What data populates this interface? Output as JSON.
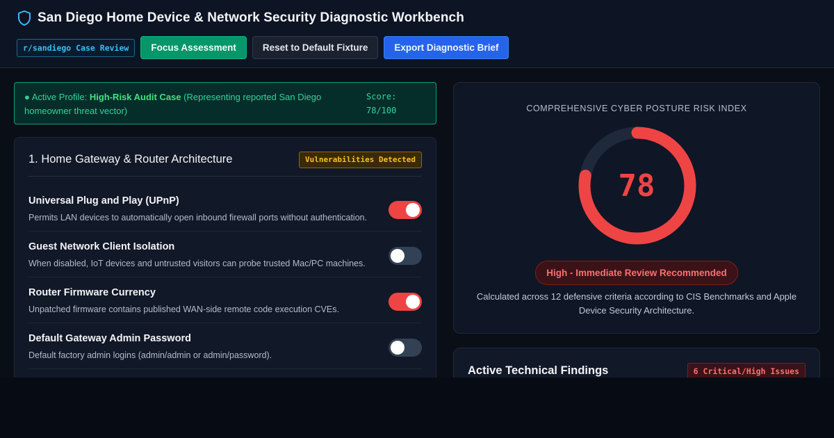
{
  "app": {
    "title": "San Diego Home Device & Network Security Diagnostic Workbench",
    "icon": "shield-icon",
    "accent": "#38bdf8"
  },
  "toolbar": {
    "case_tag": "r/sandiego Case Review",
    "focus_label": "Focus Assessment",
    "reset_label": "Reset to Default Fixture",
    "export_label": "Export Diagnostic Brief"
  },
  "profile": {
    "prefix": "● Active Profile: ",
    "name": "High-Risk Audit Case",
    "description": " (Representing reported San Diego homeowner threat vector)",
    "score_label": "Score: 78/100"
  },
  "gateway": {
    "title": "1. Home Gateway & Router Architecture",
    "badge": "Vulnerabilities Detected",
    "settings": [
      {
        "name": "Universal Plug and Play (UPnP)",
        "description": "Permits LAN devices to automatically open inbound firewall ports without authentication.",
        "enabled": true
      },
      {
        "name": "Guest Network Client Isolation",
        "description": "When disabled, IoT devices and untrusted visitors can probe trusted Mac/PC machines.",
        "enabled": false
      },
      {
        "name": "Router Firmware Currency",
        "description": "Unpatched firmware contains published WAN-side remote code execution CVEs.",
        "enabled": true
      },
      {
        "name": "Default Gateway Admin Password",
        "description": "Default factory admin logins (admin/admin or admin/password).",
        "enabled": false
      }
    ]
  },
  "risk": {
    "caption": "COMPREHENSIVE CYBER POSTURE RISK INDEX",
    "score": 78,
    "max": 100,
    "score_text": "78",
    "level": "High - Immediate Review Recommended",
    "note": "Calculated across 12 defensive criteria according to CIS Benchmarks and Apple Device Security Architecture.",
    "color": "#ef4444",
    "track_color": "#1e293b"
  },
  "findings": {
    "title": "Active Technical Findings",
    "badge": "6 Critical/High Issues"
  }
}
